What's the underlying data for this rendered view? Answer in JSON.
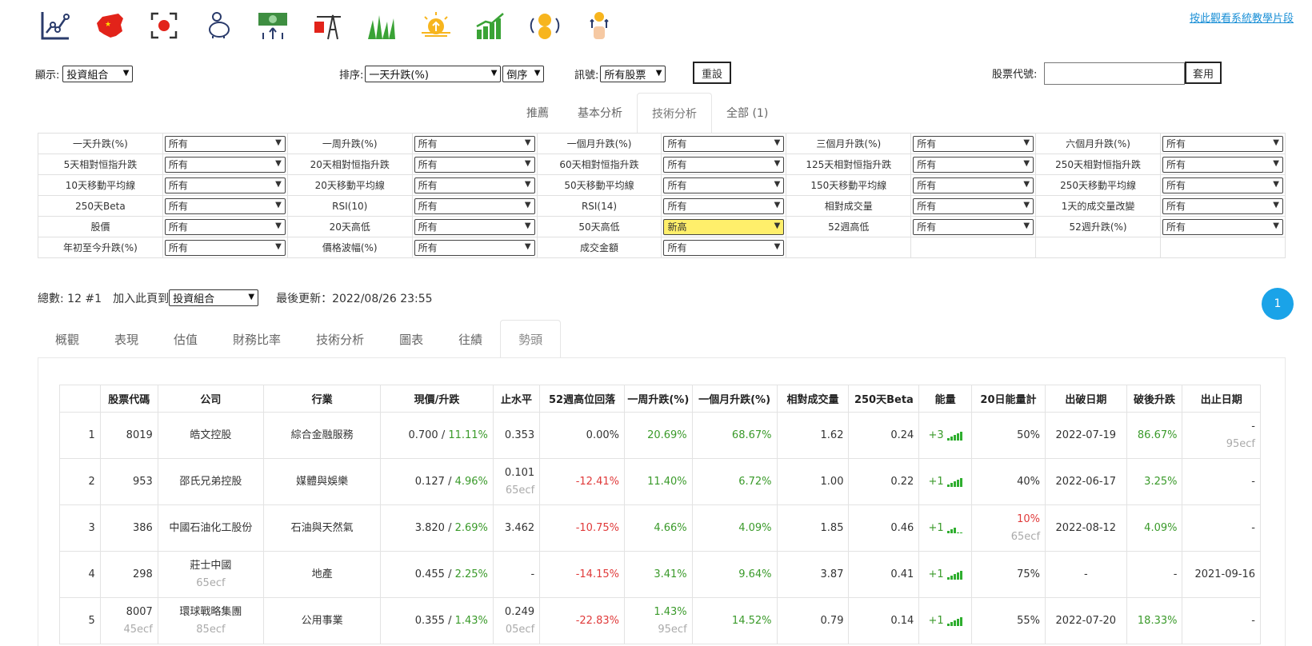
{
  "header": {
    "tutorial_link": "按此觀看系統教學片段",
    "icons": [
      "line-chart-icon",
      "china-map-icon",
      "record-icon",
      "piggy-bank-icon",
      "money-growth-icon",
      "oil-rig-icon",
      "grass-icon",
      "sunrise-icon",
      "bar-trend-icon",
      "coins-icon",
      "hand-coin-icon"
    ]
  },
  "controls": {
    "display_label": "顯示:",
    "display_value": "投資組合",
    "sort_label": "排序:",
    "sort_value": "一天升跌(%)",
    "order_value": "倒序",
    "signal_label": "訊號:",
    "signal_value": "所有股票",
    "reset_label": "重設",
    "code_label": "股票代號:",
    "apply_label": "套用"
  },
  "top_tabs": [
    "推薦",
    "基本分析",
    "技術分析",
    "全部 (1)"
  ],
  "filters": [
    [
      [
        "一天升跌(%)",
        "所有"
      ],
      [
        "一周升跌(%)",
        "所有"
      ],
      [
        "一個月升跌(%)",
        "所有"
      ],
      [
        "三個月升跌(%)",
        "所有"
      ],
      [
        "六個月升跌(%)",
        "所有"
      ]
    ],
    [
      [
        "5天相對恒指升跌",
        "所有"
      ],
      [
        "20天相對恒指升跌",
        "所有"
      ],
      [
        "60天相對恒指升跌",
        "所有"
      ],
      [
        "125天相對恒指升跌",
        "所有"
      ],
      [
        "250天相對恒指升跌",
        "所有"
      ]
    ],
    [
      [
        "10天移動平均線",
        "所有"
      ],
      [
        "20天移動平均線",
        "所有"
      ],
      [
        "50天移動平均線",
        "所有"
      ],
      [
        "150天移動平均線",
        "所有"
      ],
      [
        "250天移動平均線",
        "所有"
      ]
    ],
    [
      [
        "250天Beta",
        "所有"
      ],
      [
        "RSI(10)",
        "所有"
      ],
      [
        "RSI(14)",
        "所有"
      ],
      [
        "相對成交量",
        "所有"
      ],
      [
        "1天的成交量改變",
        "所有"
      ]
    ],
    [
      [
        "股價",
        "所有"
      ],
      [
        "20天高低",
        "所有"
      ],
      [
        "50天高低",
        "新高"
      ],
      [
        "52週高低",
        "所有"
      ],
      [
        "52週升跌(%)",
        "所有"
      ]
    ],
    [
      [
        "年初至今升跌(%)",
        "所有"
      ],
      [
        "價格波幅(%)",
        "所有"
      ],
      [
        "成交金額",
        "所有"
      ]
    ]
  ],
  "summary": {
    "count_text": "總數: 12 #1",
    "add_label": "加入此頁到",
    "add_value": "投資組合",
    "updated": "最後更新：2022/08/26 23:55",
    "page": "1"
  },
  "sub_tabs": [
    "概觀",
    "表現",
    "估值",
    "財務比率",
    "技術分析",
    "圖表",
    "往績",
    "勢頭"
  ],
  "table": {
    "headers": [
      "",
      "股票代碼",
      "公司",
      "行業",
      "現價/升跌",
      "止水平",
      "52週高位回落",
      "一周升跌(%)",
      "一個月升跌(%)",
      "相對成交量",
      "250天Beta",
      "能量",
      "20日能量計",
      "出破日期",
      "破後升跌",
      "出止日期"
    ],
    "rows": [
      {
        "idx": "1",
        "code": "8019",
        "code_sub": "",
        "company": "皓文控股",
        "company_sub": "",
        "industry": "綜合金融服務",
        "price": "0.700",
        "change": "11.11%",
        "stop": "0.353",
        "stop_sub": "",
        "drop": "0.00%",
        "week": "20.69%",
        "week_sub": "",
        "month": "68.67%",
        "relvol": "1.62",
        "beta": "0.24",
        "energy": "+3",
        "bars": [
          3,
          5,
          7,
          9,
          11
        ],
        "meter": "50%",
        "meter_sub": "",
        "break_date": "2022-07-19",
        "after": "86.67%",
        "stop_date": "-",
        "stop_date_sub": "95ecf"
      },
      {
        "idx": "2",
        "code": "953",
        "code_sub": "",
        "company": "邵氏兄弟控股",
        "company_sub": "",
        "industry": "媒體與娛樂",
        "price": "0.127",
        "change": "4.96%",
        "stop": "0.101",
        "stop_sub": "65ecf",
        "drop": "-12.41%",
        "week": "11.40%",
        "week_sub": "",
        "month": "6.72%",
        "relvol": "1.00",
        "beta": "0.22",
        "energy": "+1",
        "bars": [
          3,
          5,
          7,
          9,
          11
        ],
        "meter": "40%",
        "meter_sub": "",
        "break_date": "2022-06-17",
        "after": "3.25%",
        "stop_date": "-",
        "stop_date_sub": ""
      },
      {
        "idx": "3",
        "code": "386",
        "code_sub": "",
        "company": "中國石油化工股份",
        "company_sub": "",
        "industry": "石油與天然氣",
        "price": "3.820",
        "change": "2.69%",
        "stop": "3.462",
        "stop_sub": "",
        "drop": "-10.75%",
        "week": "4.66%",
        "week_sub": "",
        "month": "4.09%",
        "relvol": "1.85",
        "beta": "0.46",
        "energy": "+1",
        "bars": [
          3,
          5,
          7,
          0,
          0
        ],
        "meter": "10%",
        "meter_sub": "65ecf",
        "break_date": "2022-08-12",
        "after": "4.09%",
        "stop_date": "-",
        "stop_date_sub": ""
      },
      {
        "idx": "4",
        "code": "298",
        "code_sub": "",
        "company": "莊士中國",
        "company_sub": "65ecf",
        "industry": "地產",
        "price": "0.455",
        "change": "2.25%",
        "stop": "-",
        "stop_sub": "",
        "drop": "-14.15%",
        "week": "3.41%",
        "week_sub": "",
        "month": "9.64%",
        "relvol": "3.87",
        "beta": "0.41",
        "energy": "+1",
        "bars": [
          3,
          5,
          7,
          9,
          11
        ],
        "meter": "75%",
        "meter_sub": "",
        "break_date": "-",
        "after": "-",
        "stop_date": "2021-09-16",
        "stop_date_sub": ""
      },
      {
        "idx": "5",
        "code": "8007",
        "code_sub": "45ecf",
        "company": "環球戰略集團",
        "company_sub": "85ecf",
        "industry": "公用事業",
        "price": "0.355",
        "change": "1.43%",
        "stop": "0.249",
        "stop_sub": "05ecf",
        "drop": "-22.83%",
        "week": "1.43%",
        "week_sub": "95ecf",
        "month": "14.52%",
        "relvol": "0.79",
        "beta": "0.14",
        "energy": "+1",
        "bars": [
          3,
          5,
          7,
          9,
          11
        ],
        "meter": "55%",
        "meter_sub": "",
        "break_date": "2022-07-20",
        "after": "18.33%",
        "stop_date": "-",
        "stop_date_sub": ""
      }
    ]
  }
}
